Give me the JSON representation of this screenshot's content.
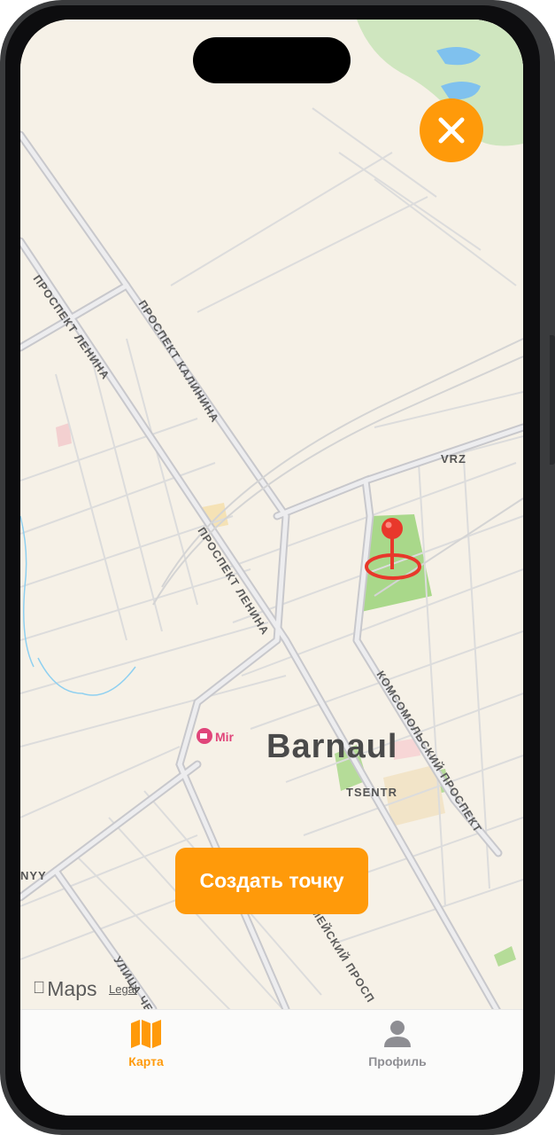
{
  "map": {
    "city_label": "Barnaul",
    "district_label": "TSENTR",
    "area_label_vrz": "VRZ",
    "area_label_nyy": "NYY",
    "poi_label": "Mir",
    "streets": {
      "lenina_upper": "ПРОСПЕКТ ЛЕНИНА",
      "kalinina": "ПРОСПЕКТ КАЛИНИНА",
      "lenina_middle": "ПРОСПЕКТ ЛЕНИНА",
      "komsomolsky": "КОМСОМОЛЬСКИЙ ПРОСПЕКТ",
      "bottom_prospekt": "МЕЙСКИЙ ПРОСП",
      "bottom_ulitsa": "УЛИЦА ЧЕ"
    },
    "attribution_brand": "Maps",
    "attribution_legal": "Legal",
    "accent_color": "#ff9a0a",
    "pin_color": "#e8382b",
    "park_color": "#a9d88a"
  },
  "actions": {
    "create_point_label": "Создать точку"
  },
  "tabbar": {
    "items": [
      {
        "label": "Карта",
        "icon": "map-icon",
        "active": true
      },
      {
        "label": "Профиль",
        "icon": "person-icon",
        "active": false
      }
    ]
  }
}
